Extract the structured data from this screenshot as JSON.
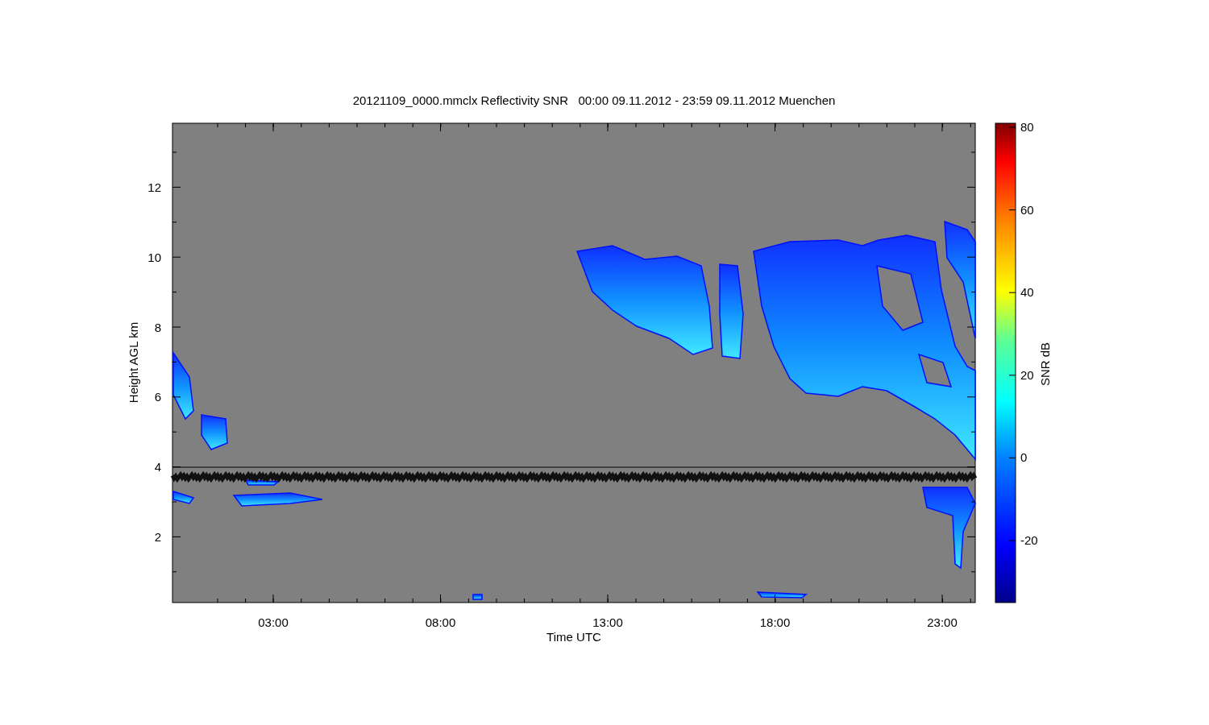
{
  "title": "20121109_0000.mmclx Reflectivity SNR   00:00 09.11.2012 - 23:59 09.11.2012 Muenchen",
  "y_axis": {
    "label": "Height AGL km",
    "ticks": [
      "12",
      "10",
      "8",
      "6",
      "4",
      "2"
    ]
  },
  "x_axis": {
    "label": "Time UTC",
    "ticks": [
      "03:00",
      "08:00",
      "13:00",
      "18:00",
      "23:00"
    ]
  },
  "colorbar": {
    "label": "SNR dB",
    "ticks": [
      "80",
      "60",
      "40",
      "20",
      "0",
      "-20"
    ]
  }
}
